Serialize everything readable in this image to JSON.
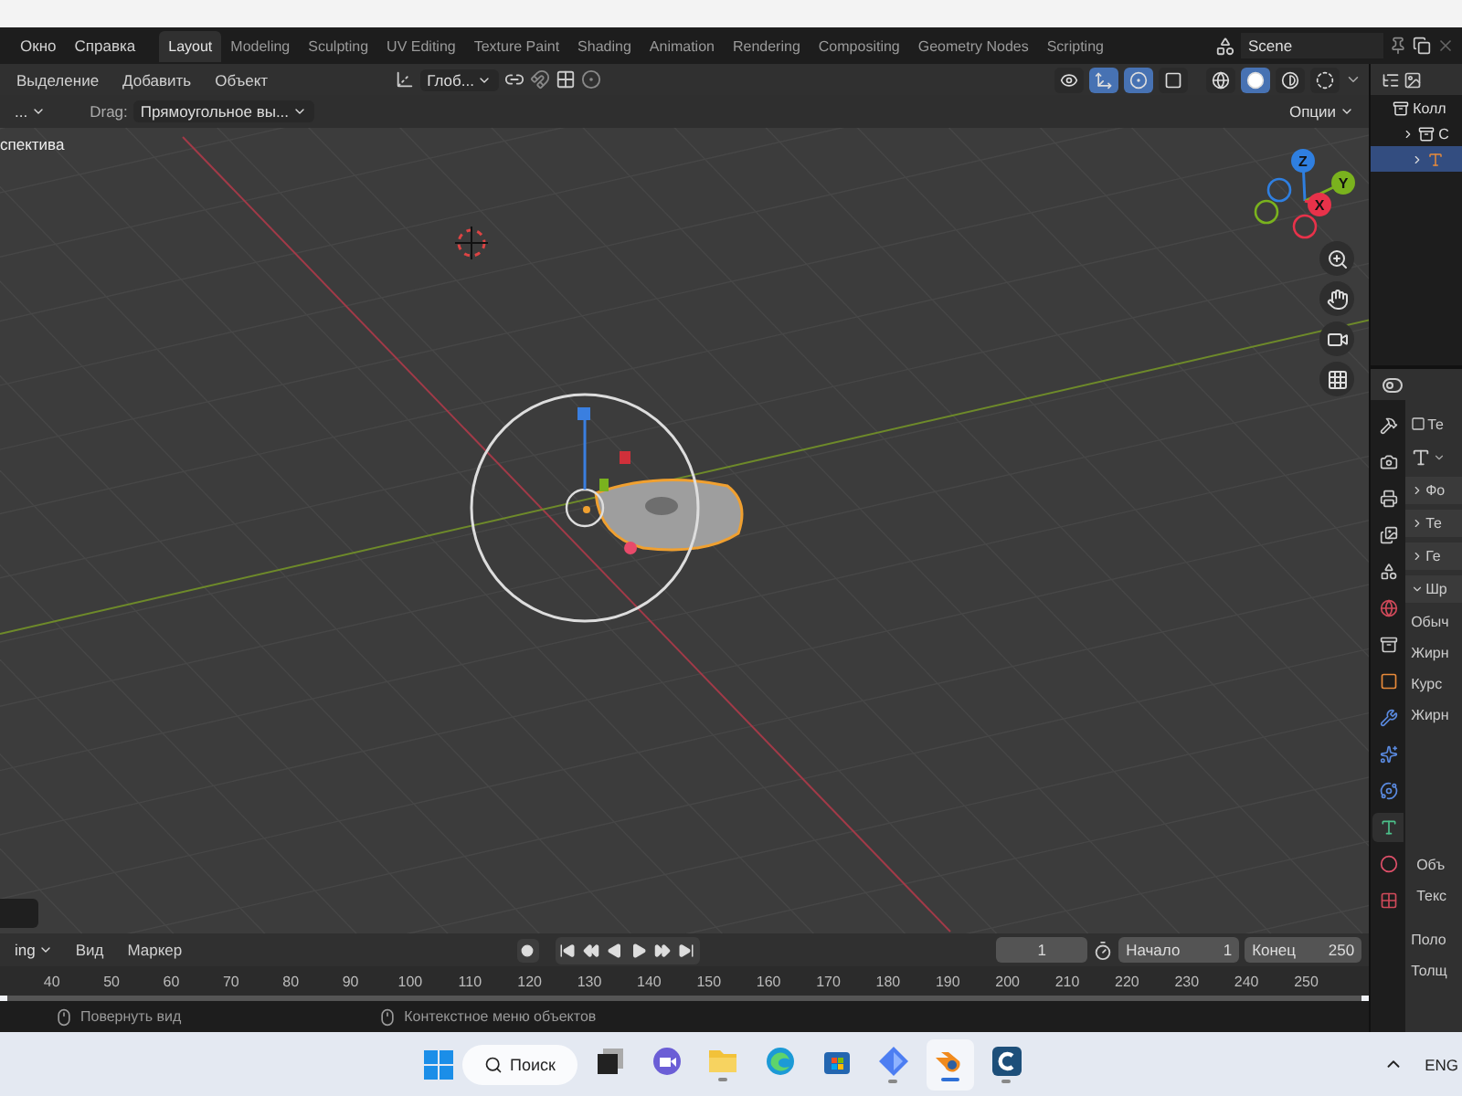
{
  "top_menu": [
    "Окно",
    "Справка"
  ],
  "workspace_tabs": [
    {
      "label": "Layout",
      "selected": true
    },
    {
      "label": "Modeling",
      "selected": false
    },
    {
      "label": "Sculpting",
      "selected": false
    },
    {
      "label": "UV Editing",
      "selected": false
    },
    {
      "label": "Texture Paint",
      "selected": false
    },
    {
      "label": "Shading",
      "selected": false
    },
    {
      "label": "Animation",
      "selected": false
    },
    {
      "label": "Rendering",
      "selected": false
    },
    {
      "label": "Compositing",
      "selected": false
    },
    {
      "label": "Geometry Nodes",
      "selected": false
    },
    {
      "label": "Scripting",
      "selected": false
    }
  ],
  "scene": {
    "name": "Scene"
  },
  "viewport_header": {
    "menus": [
      "Выделение",
      "Добавить",
      "Объект"
    ],
    "orientation": "Глоб...",
    "toggles": [
      {
        "kind": "visibility",
        "on": false
      },
      {
        "kind": "gizmo",
        "on": true
      },
      {
        "kind": "overlay",
        "on": true
      },
      {
        "kind": "xray",
        "on": false
      }
    ],
    "shading_modes": [
      {
        "kind": "wireframe",
        "selected": false
      },
      {
        "kind": "solid",
        "selected": true
      },
      {
        "kind": "material",
        "selected": false
      },
      {
        "kind": "rendered",
        "selected": false
      }
    ]
  },
  "tool_header": {
    "mode": "...",
    "drag_label": "Drag:",
    "drag_value": "Прямоугольное вы...",
    "options": "Опции"
  },
  "viewport": {
    "view_label": "спектива",
    "axes": [
      {
        "label": "Z",
        "color": "#2f7fe0"
      },
      {
        "label": "Y",
        "color": "#7ab21e"
      },
      {
        "label": "X",
        "color": "#e8324a"
      }
    ]
  },
  "outliner": {
    "rows": [
      {
        "label": "Колл",
        "selected": false
      },
      {
        "label": "С",
        "selected": false
      },
      {
        "selected": true
      }
    ]
  },
  "properties": {
    "tabs": [
      {
        "kind": "tool",
        "selected": false
      },
      {
        "kind": "render",
        "selected": false
      },
      {
        "kind": "output",
        "selected": false
      },
      {
        "kind": "view_layer",
        "selected": false
      },
      {
        "kind": "scene",
        "selected": false
      },
      {
        "kind": "world",
        "selected": false
      },
      {
        "kind": "collection",
        "selected": false
      },
      {
        "kind": "object",
        "selected": false
      },
      {
        "kind": "modifier",
        "selected": false
      },
      {
        "kind": "particles",
        "selected": false
      },
      {
        "kind": "physics",
        "selected": false
      },
      {
        "kind": "data",
        "selected": true
      },
      {
        "kind": "material",
        "selected": false
      },
      {
        "kind": "texture",
        "selected": false
      }
    ],
    "object_name": "Те",
    "panels": [
      {
        "label": "Фо",
        "expanded": false
      },
      {
        "label": "Те",
        "expanded": false
      },
      {
        "label": "Ге",
        "expanded": false
      },
      {
        "label": "Шр",
        "expanded": true
      }
    ],
    "font_fields": [
      "Обыч",
      "Жирн",
      "Курс",
      "Жирн"
    ],
    "lower_fields": [
      "Объ",
      "Текс"
    ],
    "bottom_fields": [
      "Поло",
      "Толщ"
    ]
  },
  "timeline": {
    "mode": "ing",
    "menus": [
      "Вид",
      "Маркер"
    ],
    "current_frame": "1",
    "start_label": "Начало",
    "start": "1",
    "end_label": "Конец",
    "end": "250",
    "ruler": [
      "40",
      "50",
      "60",
      "70",
      "80",
      "90",
      "100",
      "110",
      "120",
      "130",
      "140",
      "150",
      "160",
      "170",
      "180",
      "190",
      "200",
      "210",
      "220",
      "230",
      "240",
      "250"
    ]
  },
  "status_bar": [
    "Повернуть вид",
    "Контекстное меню объектов"
  ],
  "taskbar": {
    "search": "Поиск",
    "apps": [
      {
        "kind": "task_view",
        "running": false,
        "active": false
      },
      {
        "kind": "chat",
        "running": false,
        "active": false
      },
      {
        "kind": "folder",
        "running": true,
        "active": false
      },
      {
        "kind": "browser",
        "running": false,
        "active": false
      },
      {
        "kind": "store",
        "running": false,
        "active": false
      },
      {
        "kind": "diamond",
        "running": true,
        "active": false
      },
      {
        "kind": "blender",
        "running": true,
        "active": true
      },
      {
        "kind": "c_app",
        "running": true,
        "active": false
      }
    ],
    "lang": "ENG"
  }
}
